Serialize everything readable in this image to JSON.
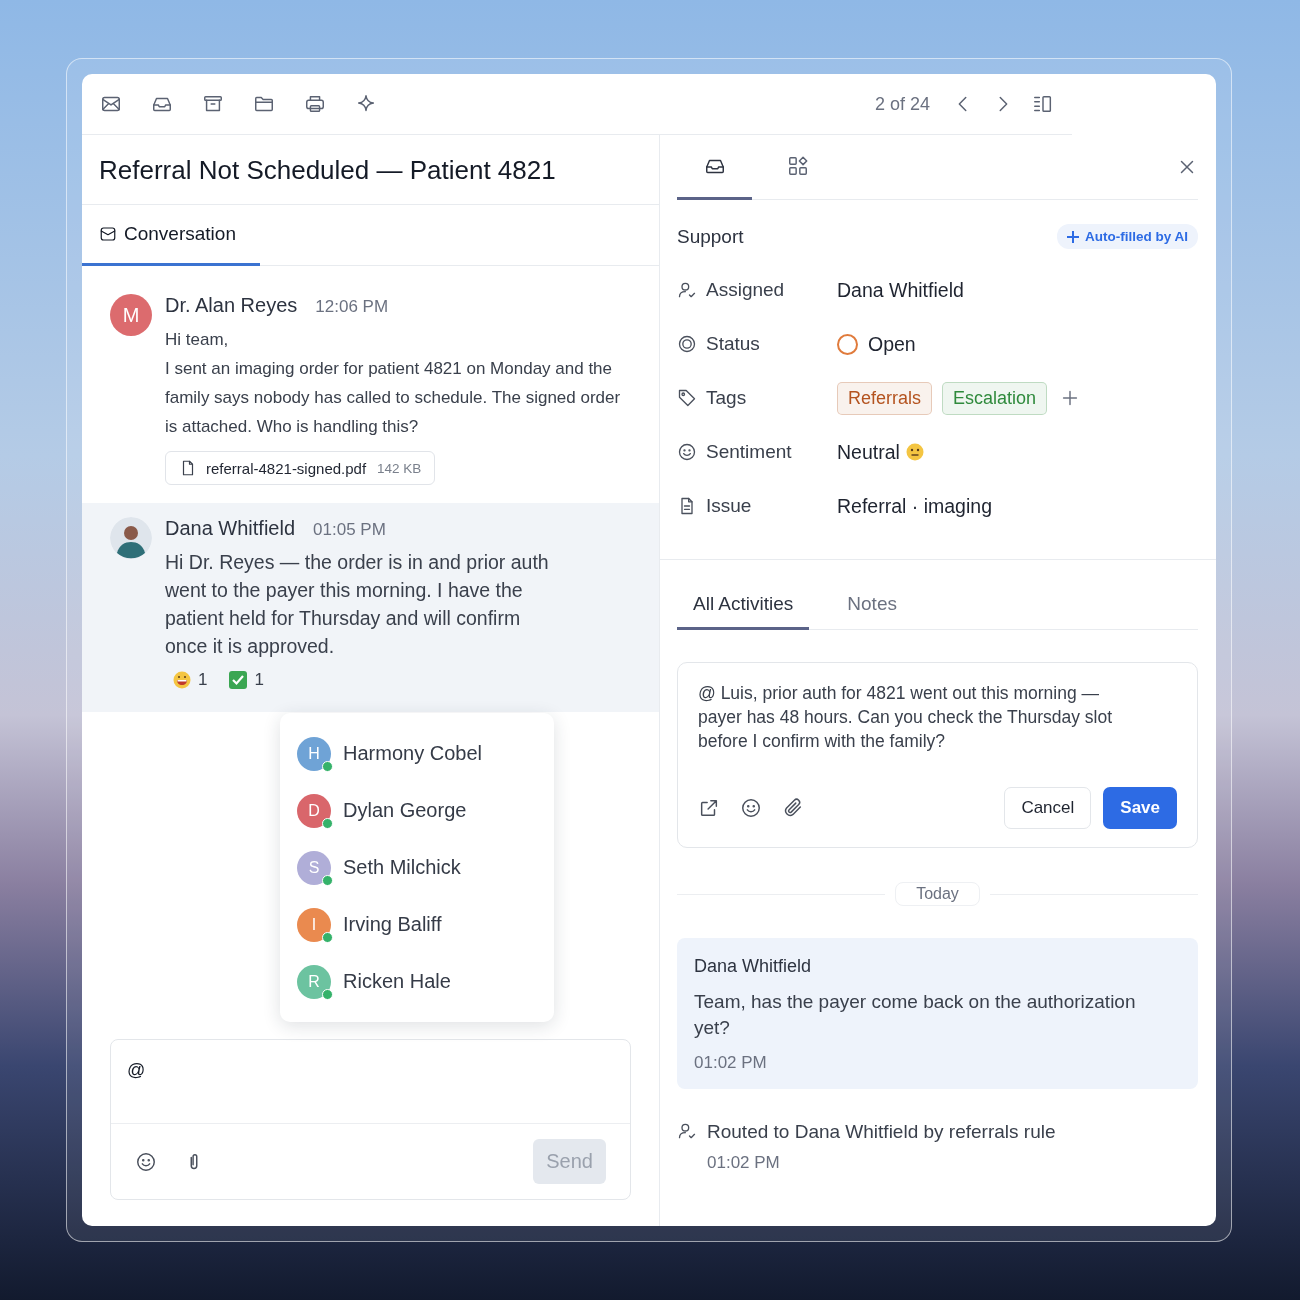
{
  "toolbar": {
    "pager": "2 of 24"
  },
  "title": "Referral Not Scheduled — Patient 4821",
  "tabs": [
    {
      "label": "Conversation",
      "selected": true
    }
  ],
  "messages": [
    {
      "author": "Dr. Alan Reyes",
      "time": "12:06 PM",
      "avatar": {
        "kind": "initial",
        "letter": "M",
        "color": "#dc6b6e"
      },
      "highlighted": false,
      "paragraphs": [
        "Hi team,",
        "I sent an imaging order for patient 4821 on Monday and the family says nobody has called to schedule. The signed order is attached. Who is handling this?"
      ],
      "attachment": {
        "name": "referral-4821-signed.pdf",
        "size": "142 KB"
      }
    },
    {
      "author": "Dana Whitfield",
      "time": "01:05 PM",
      "avatar": {
        "kind": "photo"
      },
      "highlighted": true,
      "paragraphs": [
        "Hi Dr. Reyes — the order is in and prior auth went to the payer this morning. I have the patient held for Thursday and will confirm once it is approved."
      ],
      "reactions": [
        {
          "kind": "grin",
          "count": "1"
        },
        {
          "kind": "check",
          "count": "1"
        }
      ]
    }
  ],
  "mention_menu": [
    {
      "letter": "H",
      "name": "Harmony Cobel",
      "color": "#6fa3d6",
      "online": true
    },
    {
      "letter": "D",
      "name": "Dylan George",
      "color": "#d9666b",
      "online": true
    },
    {
      "letter": "S",
      "name": "Seth Milchick",
      "color": "#b0aed8",
      "online": true
    },
    {
      "letter": "I",
      "name": "Irving Baliff",
      "color": "#ea8a4f",
      "online": true
    },
    {
      "letter": "R",
      "name": "Ricken Hale",
      "color": "#6cc3a0",
      "online": true
    }
  ],
  "composer": {
    "value": "@",
    "send": "Send",
    "send_disabled": true
  },
  "panel_tabs": [
    {
      "selected": true
    },
    {
      "selected": false
    }
  ],
  "section": {
    "title": "Support",
    "badge": "Auto-filled by AI"
  },
  "fields": [
    {
      "kind": "text",
      "label": "Assigned",
      "value": "Dana Whitfield"
    },
    {
      "kind": "status",
      "label": "Status",
      "value": "Open",
      "color": "#e07b3c"
    },
    {
      "kind": "tags",
      "label": "Tags",
      "tags": [
        {
          "label": "Referrals",
          "color": "#b4531f"
        },
        {
          "label": "Escalation",
          "color": "#2f8a3c"
        }
      ]
    },
    {
      "kind": "sentiment",
      "label": "Sentiment",
      "value": "Neutral"
    },
    {
      "kind": "text",
      "label": "Issue",
      "value": "Referral · imaging"
    }
  ],
  "activity_tabs": [
    {
      "label": "All Activities",
      "selected": true
    },
    {
      "label": "Notes",
      "selected": false
    }
  ],
  "note_editor": {
    "value": "@ Luis, prior auth for 4821 went out this morning — payer has 48 hours. Can you check the Thursday slot before I confirm with the family?",
    "cancel": "Cancel",
    "save": "Save"
  },
  "day_divider": "Today",
  "activities": [
    {
      "kind": "comment",
      "author": "Dana Whitfield",
      "text": "Team, has the payer come back on the authorization yet?",
      "time": "01:02 PM"
    },
    {
      "kind": "event",
      "text": "Routed to Dana Whitfield by referrals rule",
      "time": "01:02 PM"
    }
  ]
}
